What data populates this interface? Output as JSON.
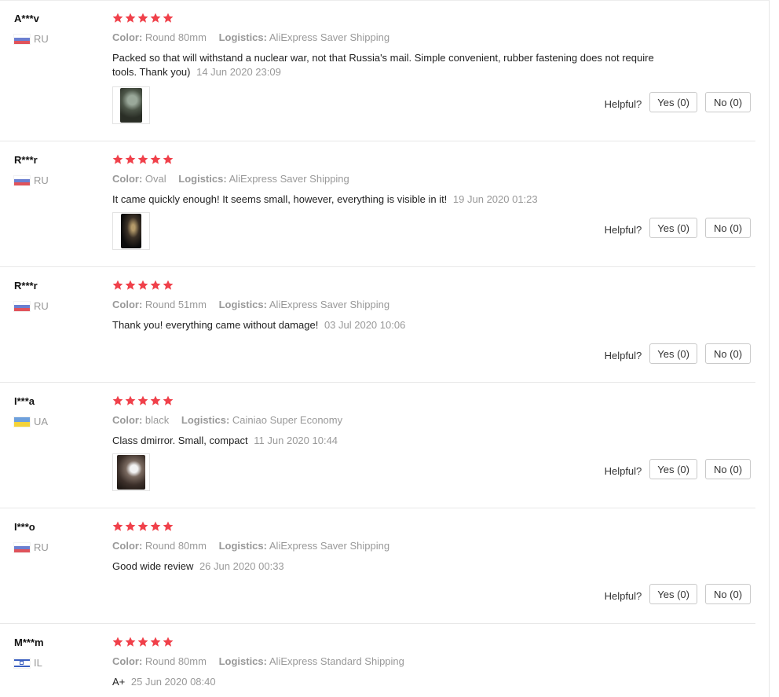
{
  "labels": {
    "color": "Color:",
    "logistics": "Logistics:",
    "helpful": "Helpful?",
    "star_color": "#f0404a"
  },
  "reviews": [
    {
      "user": "A***v",
      "country": "RU",
      "flag": "ru-flag-icon",
      "rating": 5,
      "color": "Round 80mm",
      "logistics": "AliExpress Saver Shipping",
      "text": "Packed so that will withstand a nuclear war, not that Russia's mail. Simple convenient, rubber fastening does not require tools. Thank you)",
      "date": "14 Jun 2020 23:09",
      "has_image": true,
      "yes": "Yes (0)",
      "no": "No (0)"
    },
    {
      "user": "R***r",
      "country": "RU",
      "flag": "ru-flag-icon",
      "rating": 5,
      "color": "Oval",
      "logistics": "AliExpress Saver Shipping",
      "text": "It came quickly enough! It seems small, however, everything is visible in it!",
      "date": "19 Jun 2020 01:23",
      "has_image": true,
      "yes": "Yes (0)",
      "no": "No (0)"
    },
    {
      "user": "R***r",
      "country": "RU",
      "flag": "ru-flag-icon",
      "rating": 5,
      "color": "Round 51mm",
      "logistics": "AliExpress Saver Shipping",
      "text": "Thank you! everything came without damage!",
      "date": "03 Jul 2020 10:06",
      "has_image": false,
      "yes": "Yes (0)",
      "no": "No (0)"
    },
    {
      "user": "I***a",
      "country": "UA",
      "flag": "ua-flag-icon",
      "rating": 5,
      "color": "black",
      "logistics": "Cainiao Super Economy",
      "text": "Class dmirror. Small, compact",
      "date": "11 Jun 2020 10:44",
      "has_image": true,
      "yes": "Yes (0)",
      "no": "No (0)"
    },
    {
      "user": "I***o",
      "country": "RU",
      "flag": "ru-flag-icon",
      "rating": 5,
      "color": "Round 80mm",
      "logistics": "AliExpress Saver Shipping",
      "text": "Good wide review",
      "date": "26 Jun 2020 00:33",
      "has_image": false,
      "yes": "Yes (0)",
      "no": "No (0)"
    },
    {
      "user": "M***m",
      "country": "IL",
      "flag": "il-flag-icon",
      "rating": 5,
      "color": "Round 80mm",
      "logistics": "AliExpress Standard Shipping",
      "text": "A+",
      "date": "25 Jun 2020 08:40",
      "has_image": false,
      "yes": "Yes (0)",
      "no": "No (0)"
    }
  ]
}
